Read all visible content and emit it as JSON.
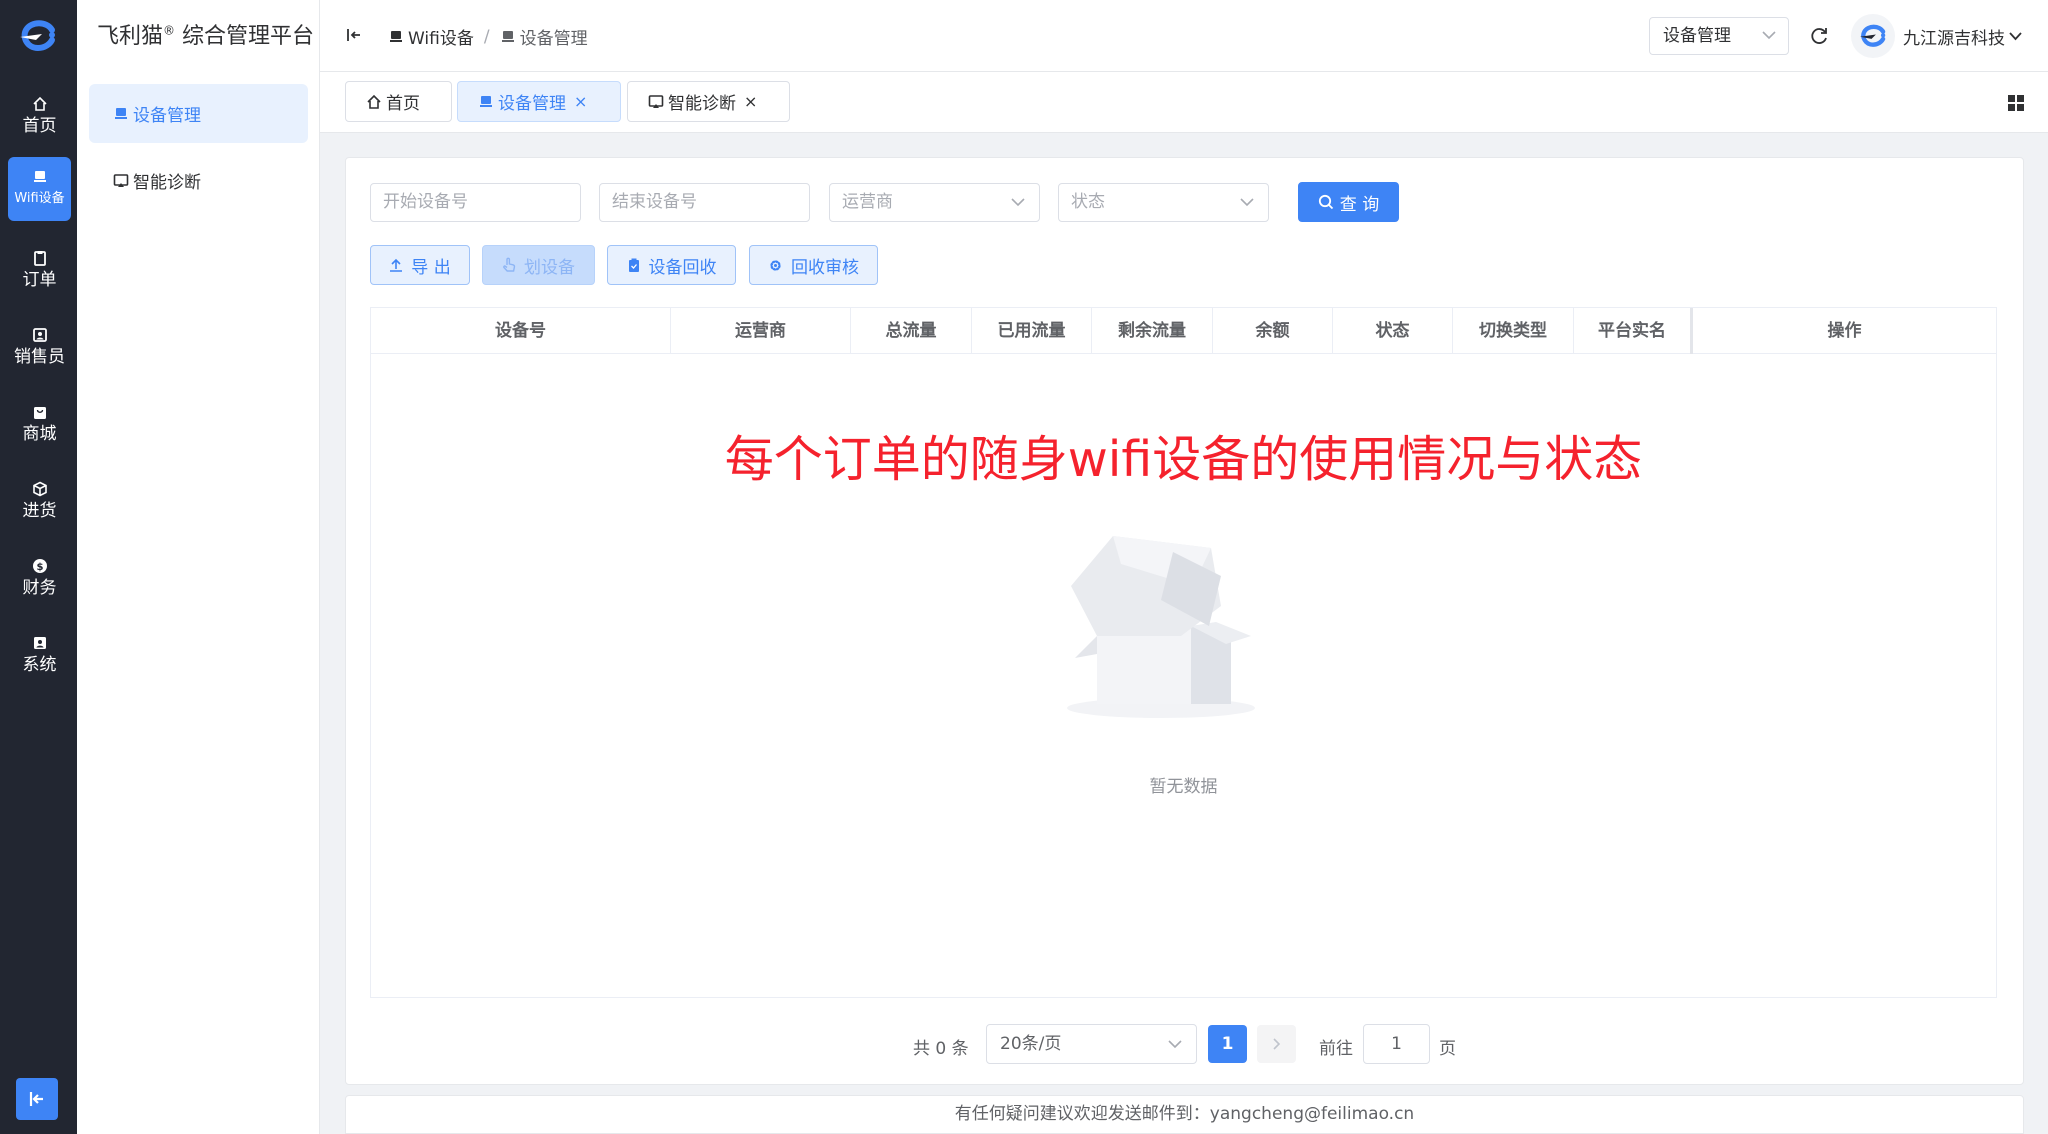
{
  "app": {
    "brand_name": "飞利猫",
    "brand_mark": "®",
    "brand_suffix": " 综合管理平台"
  },
  "rail": {
    "items": [
      {
        "label": "首页",
        "icon": "home-icon"
      },
      {
        "label": "Wifi设备",
        "icon": "monitor-icon",
        "active": true
      },
      {
        "label": "订单",
        "icon": "clipboard-icon"
      },
      {
        "label": "销售员",
        "icon": "user-card-icon"
      },
      {
        "label": "商城",
        "icon": "shop-bag-icon"
      },
      {
        "label": "进货",
        "icon": "box-icon"
      },
      {
        "label": "财务",
        "icon": "coin-icon"
      },
      {
        "label": "系统",
        "icon": "system-user-icon"
      }
    ]
  },
  "sidebar": {
    "items": [
      {
        "label": "设备管理",
        "icon": "monitor-icon",
        "active": true
      },
      {
        "label": "智能诊断",
        "icon": "screen-cast-icon"
      }
    ]
  },
  "header": {
    "breadcrumb": [
      "Wifi设备",
      "设备管理"
    ],
    "separator": "/",
    "module_select": "设备管理",
    "company": "九江源吉科技"
  },
  "tags": [
    {
      "label": "首页",
      "icon": "home-icon",
      "closable": false
    },
    {
      "label": "设备管理",
      "icon": "monitor-icon",
      "closable": true,
      "active": true
    },
    {
      "label": "智能诊断",
      "icon": "screen-cast-icon",
      "closable": true
    }
  ],
  "close_glyph": "×",
  "filters": {
    "start_device_placeholder": "开始设备号",
    "end_device_placeholder": "结束设备号",
    "operator_placeholder": "运营商",
    "status_placeholder": "状态",
    "query_label": "查 询"
  },
  "actions": {
    "export": "导 出",
    "assign": "划设备",
    "recycle": "设备回收",
    "recycle_review": "回收审核"
  },
  "table": {
    "columns": [
      "设备号",
      "运营商",
      "总流量",
      "已用流量",
      "剩余流量",
      "余额",
      "状态",
      "切换类型",
      "平台实名",
      "操作"
    ],
    "rows": [],
    "empty_text": "暂无数据",
    "overlay_caption": "每个订单的随身wifi设备的使用情况与状态"
  },
  "pagination": {
    "total_text": "共 0 条",
    "page_size": "20条/页",
    "current_page": "1",
    "goto_label": "前往",
    "goto_value": "1",
    "page_unit": "页"
  },
  "footer": {
    "text": "有任何疑问建议欢迎发送邮件到：yangcheng@feilimao.cn"
  },
  "colors": {
    "primary": "#3e84f5",
    "rail_bg": "#222631",
    "overlay_red": "#f5222d"
  }
}
